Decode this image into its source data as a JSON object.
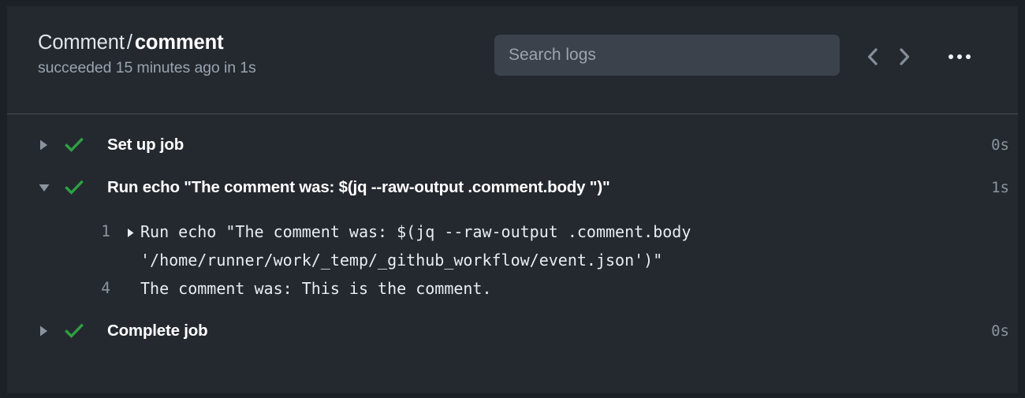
{
  "header": {
    "workflow_name": "Comment",
    "separator": "/",
    "job_name": "comment",
    "status_line": "succeeded 15 minutes ago in 1s",
    "search_placeholder": "Search logs",
    "search_value": "",
    "prev_icon": "chevron-left-icon",
    "next_icon": "chevron-right-icon",
    "menu_icon": "kebab-menu-icon"
  },
  "colors": {
    "panel_bg": "#24292f",
    "page_bg": "#1c2128",
    "divider": "#444c56",
    "success_green": "#2ea043",
    "muted_text": "#8b949e",
    "primary_text": "#ffffff",
    "search_bg": "#3c424b"
  },
  "steps": [
    {
      "name": "Set up job",
      "duration": "0s",
      "status": "success",
      "expanded": false,
      "caret": "triangle-right-icon",
      "status_icon": "check-icon"
    },
    {
      "name": "Run echo \"The comment was: $(jq --raw-output .comment.body \")\"",
      "duration": "1s",
      "status": "success",
      "expanded": true,
      "caret": "triangle-down-icon",
      "status_icon": "check-icon",
      "lines": [
        {
          "number": "1",
          "foldable": true,
          "fold_icon": "triangle-right-icon",
          "text": "Run echo \"The comment was: $(jq --raw-output .comment.body",
          "continuation": "'/home/runner/work/_temp/_github_workflow/event.json')\""
        },
        {
          "number": "4",
          "foldable": false,
          "text": "The comment was: This is the comment."
        }
      ]
    },
    {
      "name": "Complete job",
      "duration": "0s",
      "status": "success",
      "expanded": false,
      "caret": "triangle-right-icon",
      "status_icon": "check-icon"
    }
  ]
}
